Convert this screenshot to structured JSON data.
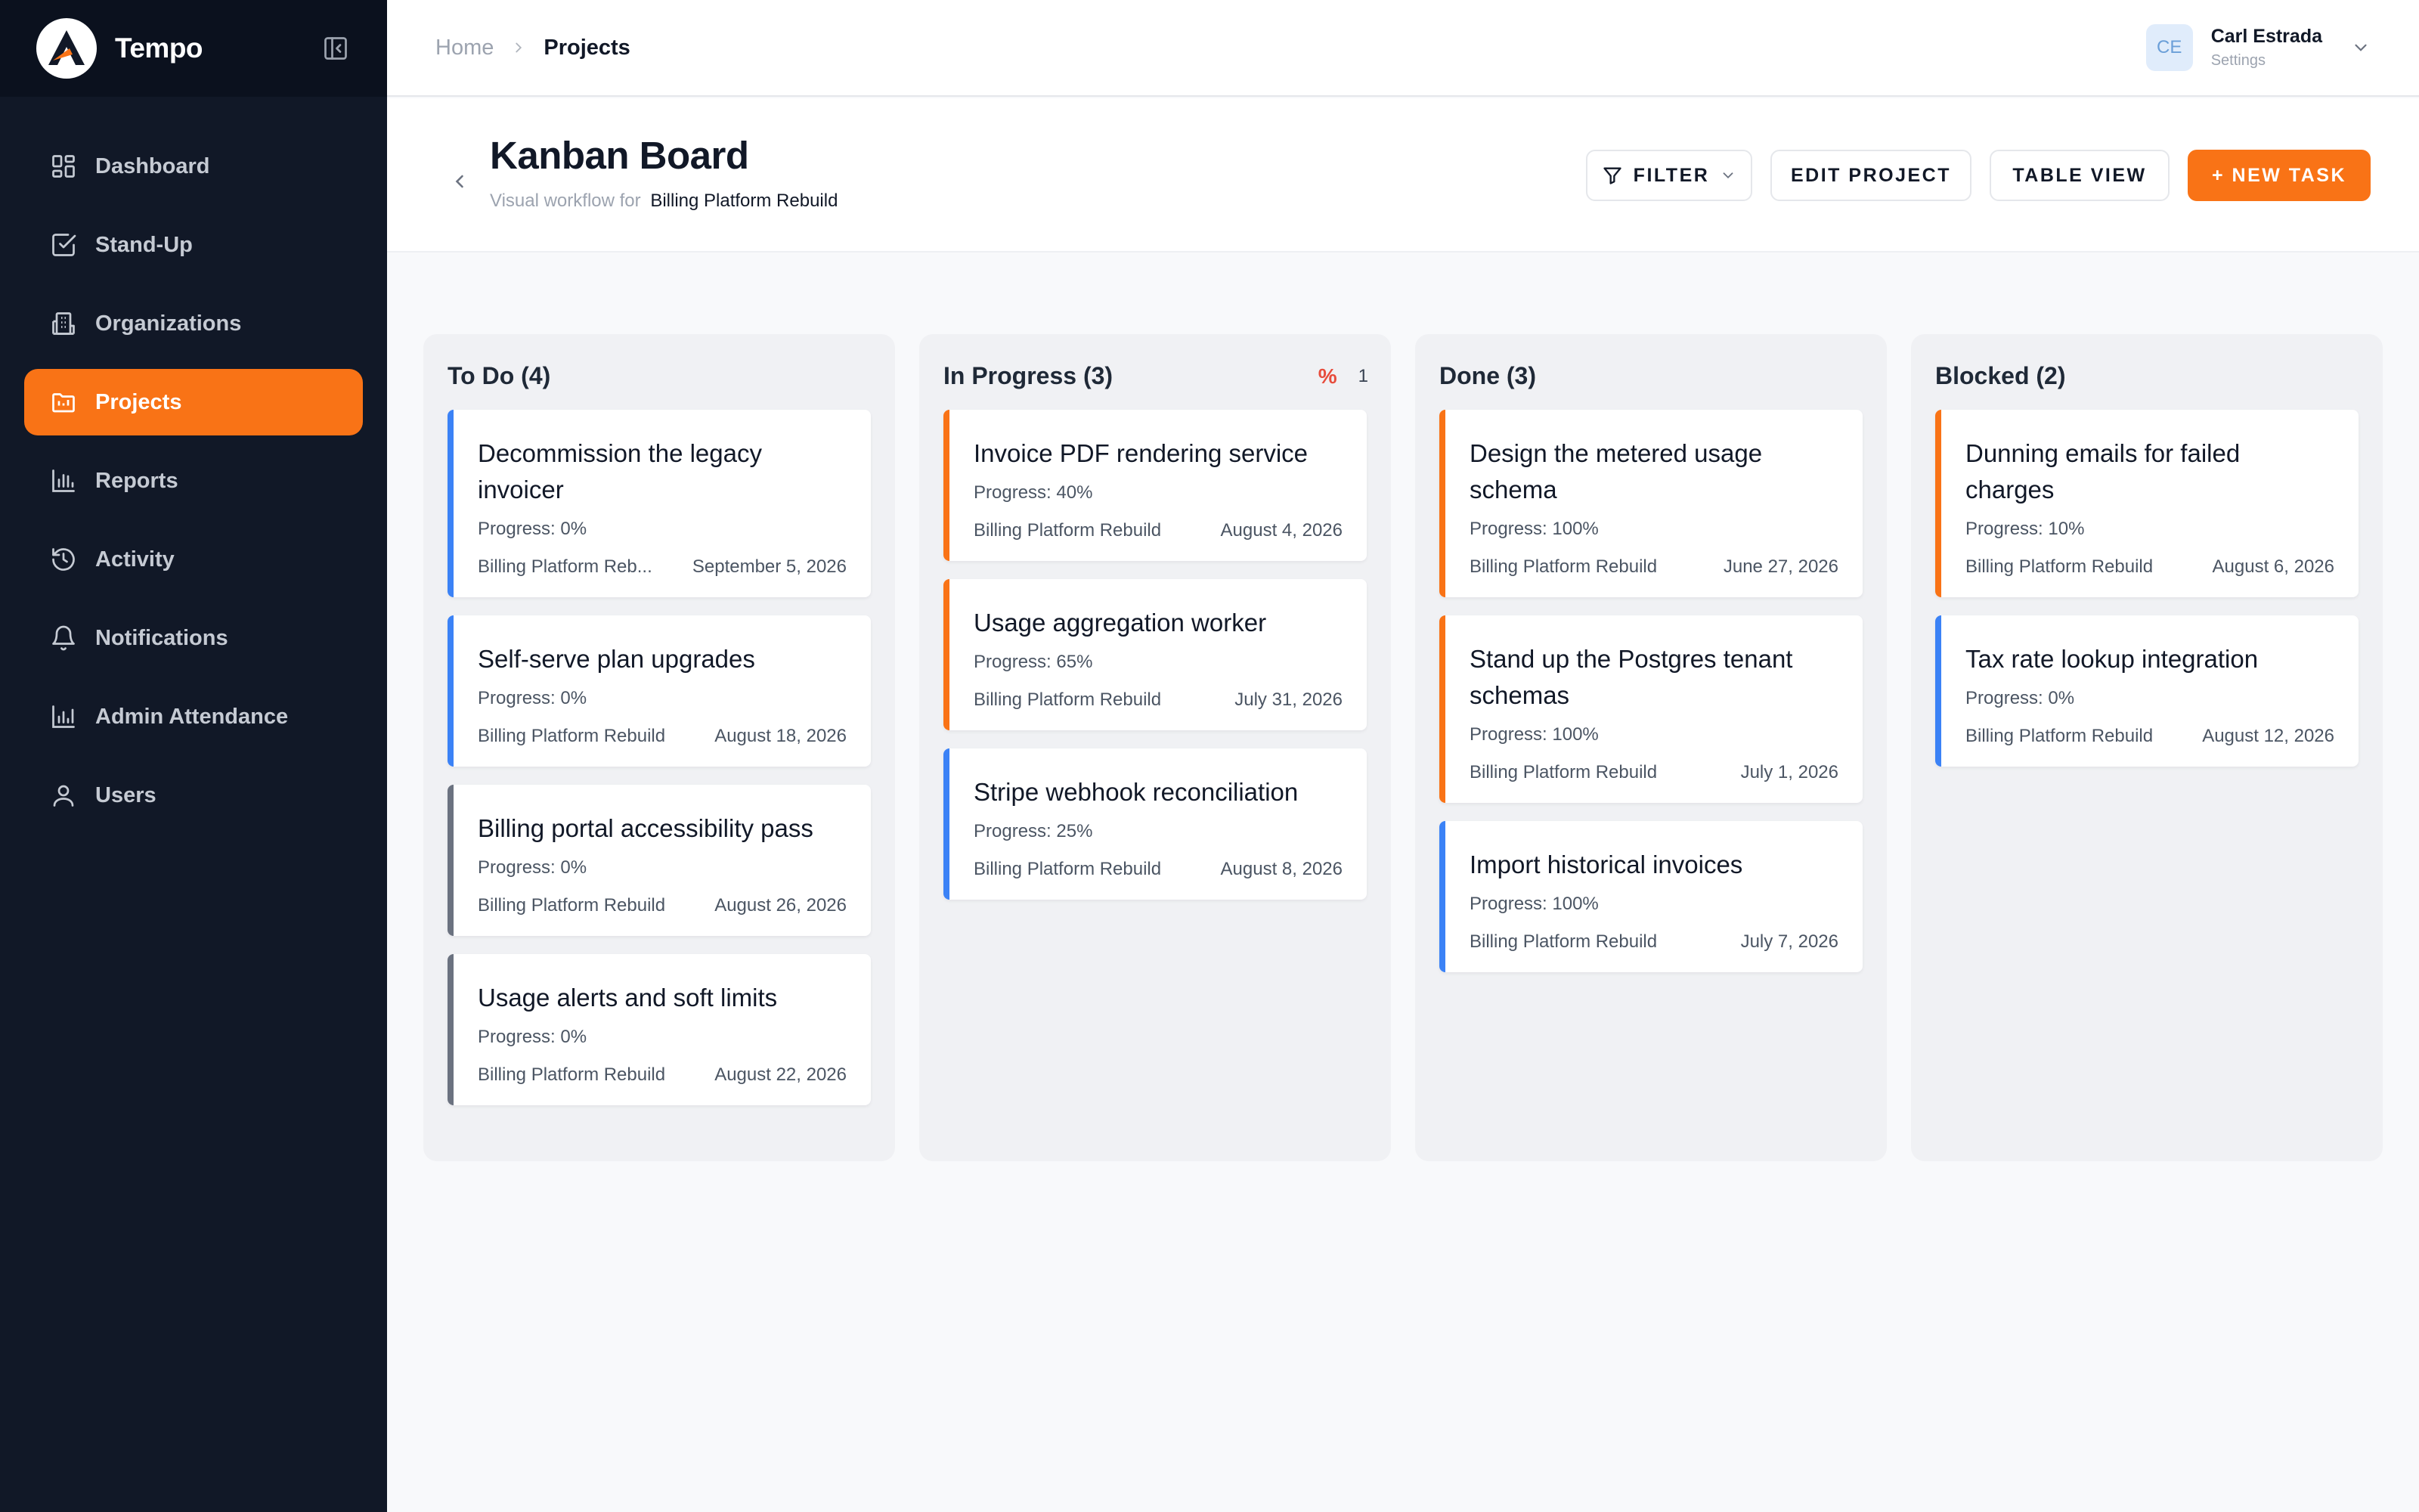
{
  "app": {
    "name": "Tempo"
  },
  "colors": {
    "accent": "#f97316",
    "sidebar_bg": "#111827",
    "stripe_blue": "#3b82f6",
    "stripe_orange": "#f97316",
    "stripe_gray": "#6b7280"
  },
  "sidebar": {
    "items": [
      {
        "label": "Dashboard",
        "icon": "dashboard-icon"
      },
      {
        "label": "Stand-Up",
        "icon": "checkbox-icon"
      },
      {
        "label": "Organizations",
        "icon": "building-icon"
      },
      {
        "label": "Projects",
        "icon": "folder-icon",
        "active": true
      },
      {
        "label": "Reports",
        "icon": "bar-chart-icon"
      },
      {
        "label": "Activity",
        "icon": "history-icon"
      },
      {
        "label": "Notifications",
        "icon": "bell-icon"
      },
      {
        "label": "Admin Attendance",
        "icon": "chart-icon"
      },
      {
        "label": "Users",
        "icon": "user-icon"
      }
    ]
  },
  "breadcrumb": {
    "home": "Home",
    "current": "Projects"
  },
  "user": {
    "initials": "CE",
    "name": "Carl Estrada",
    "sub": "Settings"
  },
  "page": {
    "title": "Kanban Board",
    "subtitle_prefix": "Visual workflow for",
    "project_name": "Billing Platform Rebuild"
  },
  "actions": {
    "filter": "FILTER",
    "edit": "EDIT PROJECT",
    "table": "TABLE VIEW",
    "new": "+ NEW TASK"
  },
  "columns": [
    {
      "title": "To Do (4)",
      "cards": [
        {
          "title": "Decommission the legacy invoicer",
          "progress": "Progress: 0%",
          "project": "Billing Platform Reb...",
          "date": "September 5, 2026",
          "stripe": "blue"
        },
        {
          "title": "Self-serve plan upgrades",
          "progress": "Progress: 0%",
          "project": "Billing Platform Rebuild",
          "date": "August 18, 2026",
          "stripe": "blue"
        },
        {
          "title": "Billing portal accessibility pass",
          "progress": "Progress: 0%",
          "project": "Billing Platform Rebuild",
          "date": "August 26, 2026",
          "stripe": "gray"
        },
        {
          "title": "Usage alerts and soft limits",
          "progress": "Progress: 0%",
          "project": "Billing Platform Rebuild",
          "date": "August 22, 2026",
          "stripe": "gray"
        }
      ]
    },
    {
      "title": "In Progress (3)",
      "indicator": {
        "symbol": "%",
        "count": "1"
      },
      "cards": [
        {
          "title": "Invoice PDF rendering service",
          "progress": "Progress: 40%",
          "project": "Billing Platform Rebuild",
          "date": "August 4, 2026",
          "stripe": "orange"
        },
        {
          "title": "Usage aggregation worker",
          "progress": "Progress: 65%",
          "project": "Billing Platform Rebuild",
          "date": "July 31, 2026",
          "stripe": "orange"
        },
        {
          "title": "Stripe webhook reconciliation",
          "progress": "Progress: 25%",
          "project": "Billing Platform Rebuild",
          "date": "August 8, 2026",
          "stripe": "blue"
        }
      ]
    },
    {
      "title": "Done (3)",
      "cards": [
        {
          "title": "Design the metered usage schema",
          "progress": "Progress: 100%",
          "project": "Billing Platform Rebuild",
          "date": "June 27, 2026",
          "stripe": "orange"
        },
        {
          "title": "Stand up the Postgres tenant schemas",
          "progress": "Progress: 100%",
          "project": "Billing Platform Rebuild",
          "date": "July 1, 2026",
          "stripe": "orange"
        },
        {
          "title": "Import historical invoices",
          "progress": "Progress: 100%",
          "project": "Billing Platform Rebuild",
          "date": "July 7, 2026",
          "stripe": "blue"
        }
      ]
    },
    {
      "title": "Blocked (2)",
      "cards": [
        {
          "title": "Dunning emails for failed charges",
          "progress": "Progress: 10%",
          "project": "Billing Platform Rebuild",
          "date": "August 6, 2026",
          "stripe": "orange"
        },
        {
          "title": "Tax rate lookup integration",
          "progress": "Progress: 0%",
          "project": "Billing Platform Rebuild",
          "date": "August 12, 2026",
          "stripe": "blue"
        }
      ]
    }
  ]
}
